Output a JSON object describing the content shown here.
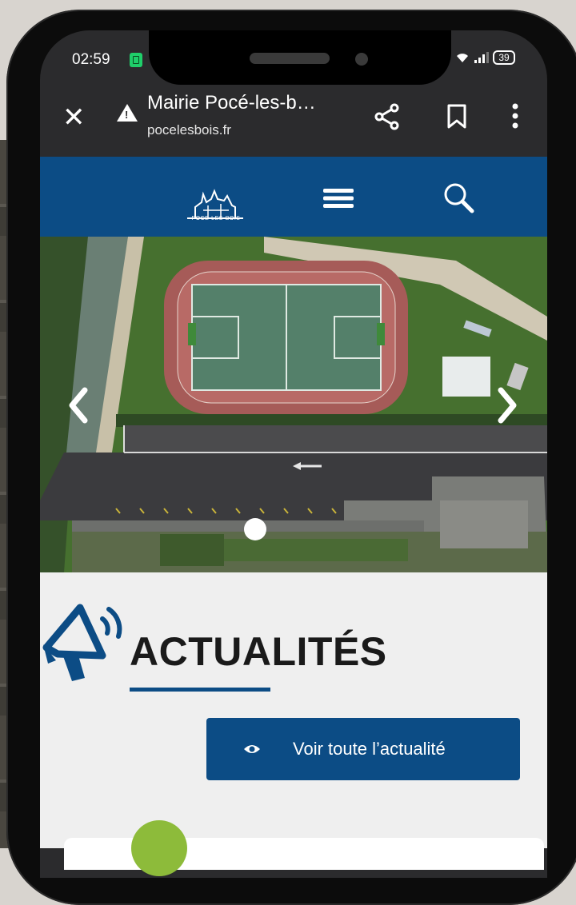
{
  "status_bar": {
    "time": "02:59",
    "battery": "39"
  },
  "browser": {
    "page_title": "Mairie Pocé-les-b…",
    "url": "pocelesbois.fr",
    "icons": [
      "close-icon",
      "warning-icon",
      "share-icon",
      "bookmark-icon",
      "more-icon"
    ]
  },
  "site_header": {
    "logo_text": "POCE-LES-BOIS",
    "icons": [
      "menu-icon",
      "search-icon"
    ],
    "background_color": "#0c4c85"
  },
  "hero": {
    "slide_count_visible": 1,
    "icons": [
      "chevron-left-icon",
      "chevron-right-icon"
    ]
  },
  "news": {
    "title": "ACTUALITÉS",
    "button_label": "Voir toute l’actualité",
    "accent_color": "#0c4c85"
  }
}
